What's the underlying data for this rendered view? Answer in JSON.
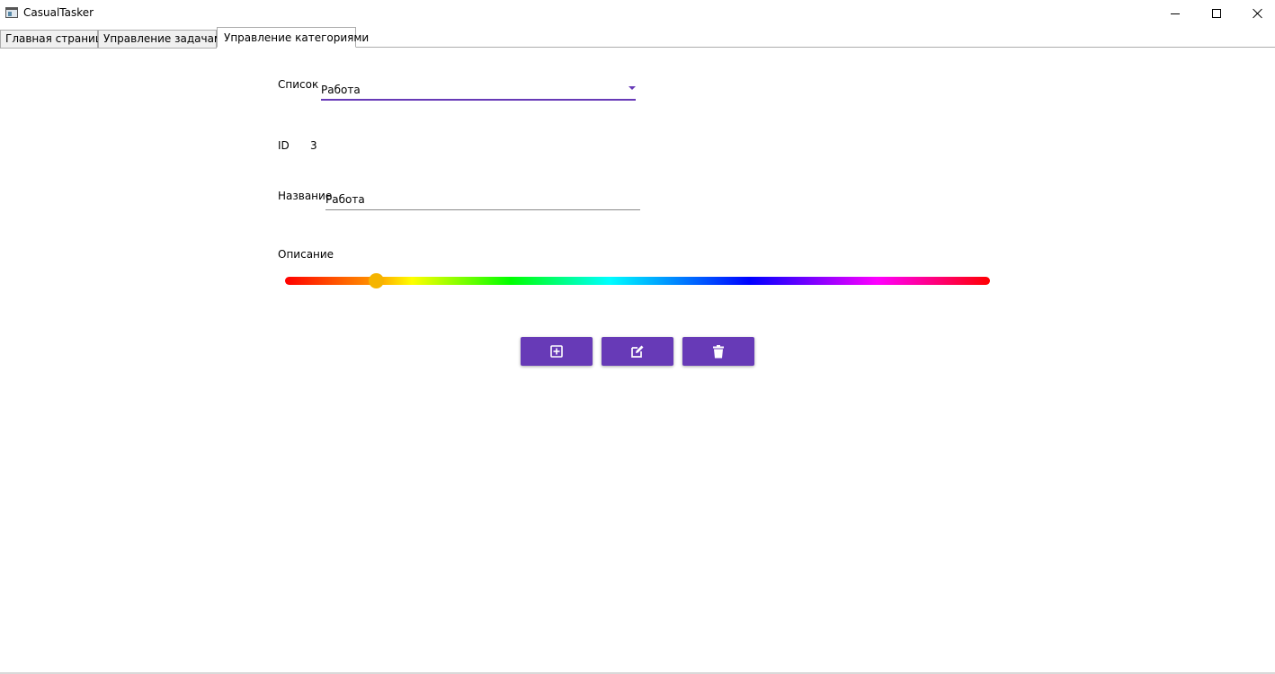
{
  "window": {
    "title": "CasualTasker",
    "icons": {
      "app": "app-window-icon",
      "minimize": "minimize-icon",
      "maximize": "maximize-icon",
      "close": "close-icon"
    }
  },
  "tabs": [
    {
      "label": "Главная страница",
      "selected": false
    },
    {
      "label": "Управление задачами",
      "selected": false
    },
    {
      "label": "Управление категориями",
      "selected": true
    }
  ],
  "form": {
    "list_label": "Список",
    "list_value": "Работа",
    "id_label": "ID",
    "id_value": "3",
    "name_label": "Название",
    "name_value": "Работа",
    "description_label": "Описание",
    "hue_fraction": 0.13
  },
  "actions": [
    {
      "name": "add",
      "icon": "plus-box-icon"
    },
    {
      "name": "edit",
      "icon": "pencil-square-icon"
    },
    {
      "name": "delete",
      "icon": "trash-icon"
    }
  ],
  "colors": {
    "accent": "#673ab7",
    "thumb": "#f5b400"
  }
}
